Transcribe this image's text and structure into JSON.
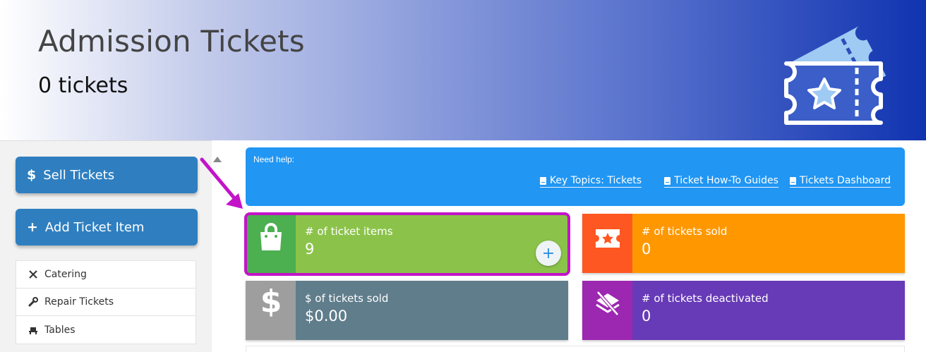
{
  "header": {
    "title": "Admission Tickets",
    "count": "0 tickets",
    "art_icon": "ticket-star-icon"
  },
  "sidebar": {
    "sell_button": {
      "glyph": "$",
      "label": "Sell Tickets"
    },
    "add_button": {
      "glyph": "+",
      "label": "Add Ticket Item"
    },
    "items": [
      {
        "label": "Catering",
        "icon": "fork-knife-icon"
      },
      {
        "label": "Repair Tickets",
        "icon": "wrench-icon"
      },
      {
        "label": "Tables",
        "icon": "table-icon"
      }
    ]
  },
  "help": {
    "label": "Need help:",
    "links": [
      {
        "label": "Key Topics: Tickets"
      },
      {
        "label": "Ticket How-To Guides"
      },
      {
        "label": "Tickets Dashboard"
      }
    ]
  },
  "cards": [
    {
      "label": "# of ticket items",
      "value": "9",
      "icon": "shopping-bag-icon",
      "color": "#8bc34a",
      "icon_color": "#4caf50",
      "highlighted": true,
      "has_add_button": true,
      "add_glyph": "+"
    },
    {
      "label": "# of tickets sold",
      "value": "0",
      "icon": "ticket-star-icon",
      "color": "#ff9800",
      "icon_color": "#ff5722"
    },
    {
      "label": "$ of tickets sold",
      "value": "$0.00",
      "icon": "dollar-icon",
      "color": "#607d8b",
      "icon_color": "#9e9e9e"
    },
    {
      "label": "# of tickets deactivated",
      "value": "0",
      "icon": "layers-off-icon",
      "color": "#673ab7",
      "icon_color": "#9c27b0"
    }
  ],
  "colors": {
    "accent_blue": "#2196f3",
    "button_blue": "#2f7fc0",
    "highlight_magenta": "#c313c8"
  }
}
